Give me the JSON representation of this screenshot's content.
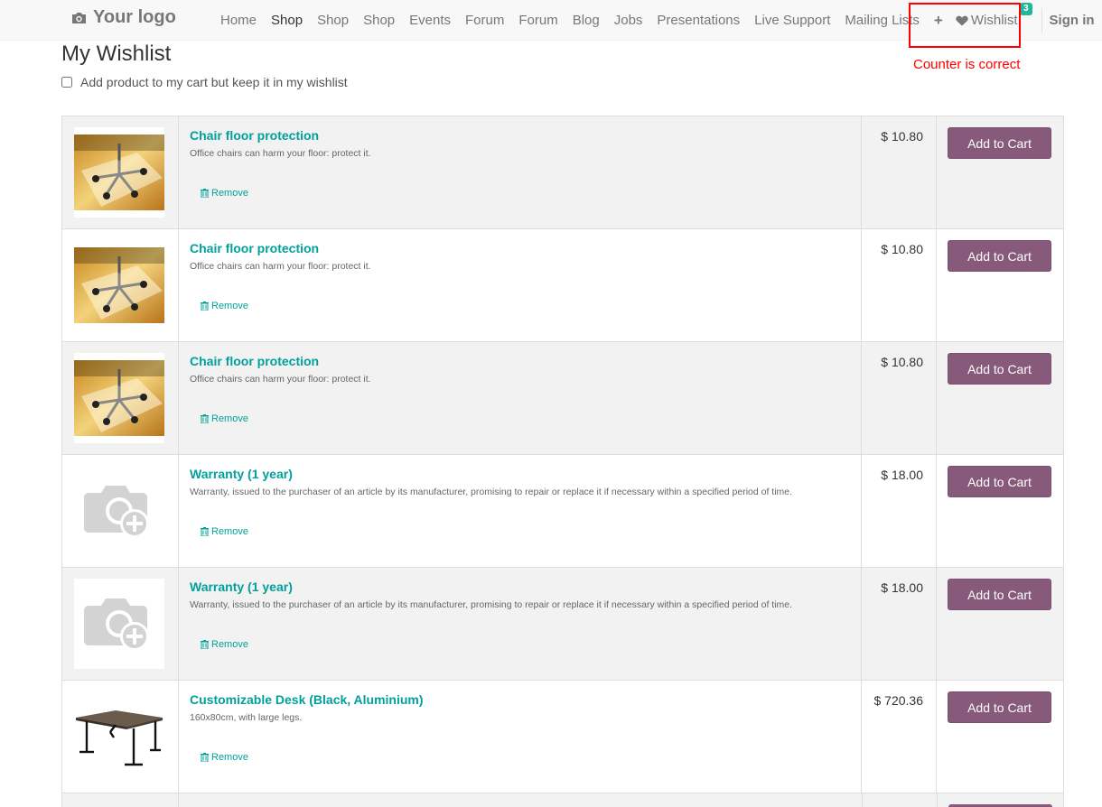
{
  "brand": {
    "logo_text": "Your logo",
    "icon": "camera-icon"
  },
  "nav": {
    "links": [
      {
        "label": "Home",
        "active": false
      },
      {
        "label": "Shop",
        "active": true
      },
      {
        "label": "Shop",
        "active": false
      },
      {
        "label": "Shop",
        "active": false
      },
      {
        "label": "Events",
        "active": false
      },
      {
        "label": "Forum",
        "active": false
      },
      {
        "label": "Forum",
        "active": false
      },
      {
        "label": "Blog",
        "active": false
      },
      {
        "label": "Jobs",
        "active": false
      },
      {
        "label": "Presentations",
        "active": false
      },
      {
        "label": "Live Support",
        "active": false
      },
      {
        "label": "Mailing Lists",
        "active": false
      }
    ],
    "plus_label": "+",
    "wishlist_label": "Wishlist",
    "wishlist_count": "3",
    "signin_label": "Sign in"
  },
  "annotation": {
    "text": "Counter is correct",
    "color": "#ff0000"
  },
  "page": {
    "title": "My Wishlist",
    "keep_checkbox_label": "Add product to my cart but keep it in my wishlist"
  },
  "colors": {
    "accent": "#00a09d",
    "button": "#875a7b",
    "badge": "#21b799"
  },
  "items": [
    {
      "name": "Chair floor protection",
      "description": "Office chairs can harm your floor: protect it.",
      "price": "$ 10.80",
      "remove_label": "Remove",
      "cart_label": "Add to Cart",
      "image": "chair-mat"
    },
    {
      "name": "Chair floor protection",
      "description": "Office chairs can harm your floor: protect it.",
      "price": "$ 10.80",
      "remove_label": "Remove",
      "cart_label": "Add to Cart",
      "image": "chair-mat"
    },
    {
      "name": "Chair floor protection",
      "description": "Office chairs can harm your floor: protect it.",
      "price": "$ 10.80",
      "remove_label": "Remove",
      "cart_label": "Add to Cart",
      "image": "chair-mat"
    },
    {
      "name": "Warranty (1 year)",
      "description": "Warranty, issued to the purchaser of an article by its manufacturer, promising to repair or replace it if necessary within a specified period of time.",
      "price": "$ 18.00",
      "remove_label": "Remove",
      "cart_label": "Add to Cart",
      "image": "placeholder"
    },
    {
      "name": "Warranty (1 year)",
      "description": "Warranty, issued to the purchaser of an article by its manufacturer, promising to repair or replace it if necessary within a specified period of time.",
      "price": "$ 18.00",
      "remove_label": "Remove",
      "cart_label": "Add to Cart",
      "image": "placeholder"
    },
    {
      "name": "Customizable Desk (Black, Aluminium)",
      "description": "160x80cm, with large legs.",
      "price": "$ 720.36",
      "remove_label": "Remove",
      "cart_label": "Add to Cart",
      "image": "desk"
    }
  ]
}
